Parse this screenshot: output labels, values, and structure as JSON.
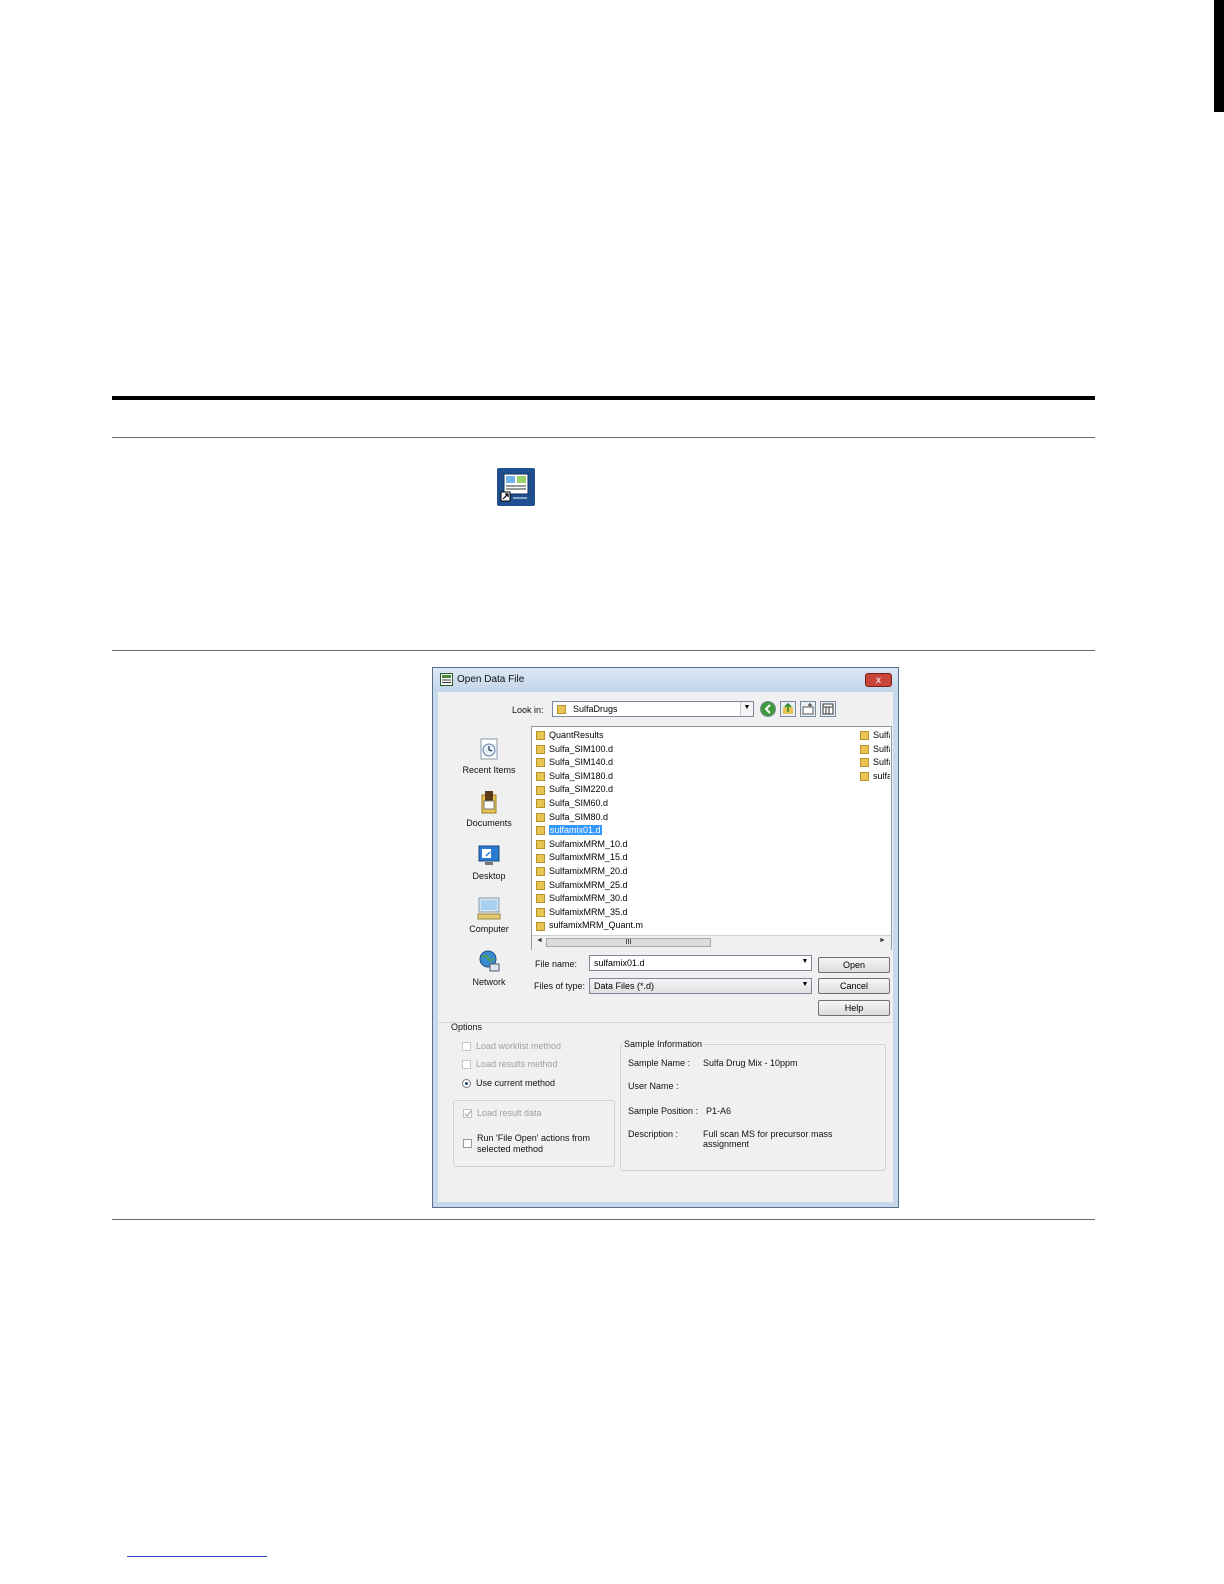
{
  "dialog": {
    "title": "Open Data File",
    "close_label": "x",
    "look_in_label": "Look in:",
    "look_in_value": "SulfaDrugs",
    "places": [
      {
        "label": "Recent Items",
        "icon": "recent-items-icon"
      },
      {
        "label": "Documents",
        "icon": "documents-icon"
      },
      {
        "label": "Desktop",
        "icon": "desktop-icon"
      },
      {
        "label": "Computer",
        "icon": "computer-icon"
      },
      {
        "label": "Network",
        "icon": "network-icon"
      }
    ],
    "files": [
      "QuantResults",
      "Sulfa_SIM100.d",
      "Sulfa_SIM140.d",
      "Sulfa_SIM180.d",
      "Sulfa_SIM220.d",
      "Sulfa_SIM60.d",
      "Sulfa_SIM80.d",
      "sulfamix01.d",
      "SulfamixMRM_10.d",
      "SulfamixMRM_15.d",
      "SulfamixMRM_20.d",
      "SulfamixMRM_25.d",
      "SulfamixMRM_30.d",
      "SulfamixMRM_35.d",
      "sulfamixMRM_Quant.m"
    ],
    "files_col2": [
      "Sulfa",
      "Sulfa",
      "Sulfa",
      "sulfa"
    ],
    "selected_file_index": 7,
    "scroll_thumb_label": "III",
    "file_name_label": "File name:",
    "file_name_value": "sulfamix01.d",
    "files_of_type_label": "Files of type:",
    "files_of_type_value": "Data Files (*.d)",
    "open_label": "Open",
    "cancel_label": "Cancel",
    "help_label": "Help",
    "options": {
      "title": "Options",
      "load_worklist_method": "Load worklist method",
      "load_results_method": "Load results method",
      "use_current_method": "Use current method",
      "load_result_data": "Load result data",
      "run_file_open_line1": "Run 'File Open' actions from",
      "run_file_open_line2": "selected method"
    },
    "sample_info": {
      "title": "Sample Information",
      "sample_name_label": "Sample Name :",
      "sample_name_value": "Sulfa Drug Mix - 10ppm",
      "user_name_label": "User Name :",
      "sample_position_label": "Sample Position :",
      "sample_position_value": "P1-A6",
      "description_label": "Description :",
      "description_line1": "Full scan MS for precursor mass",
      "description_line2": "assignment"
    }
  }
}
